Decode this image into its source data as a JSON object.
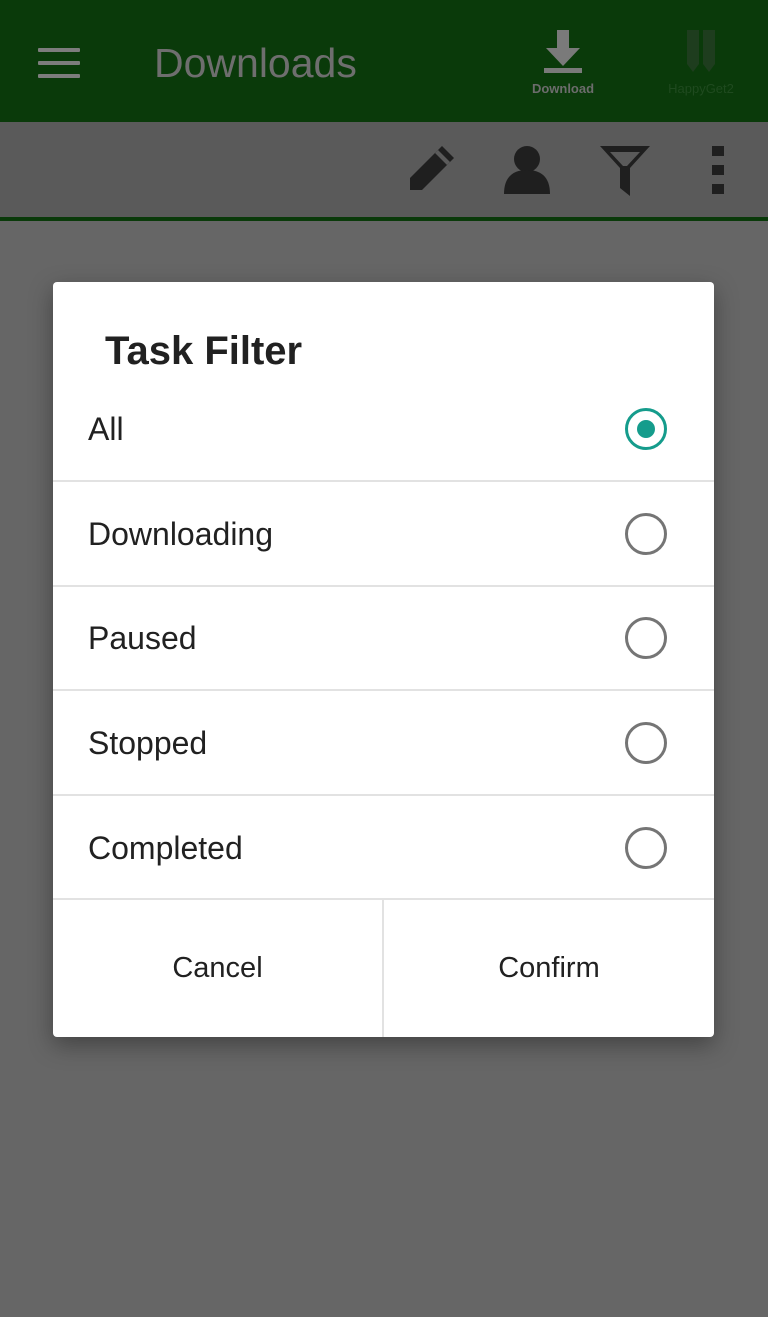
{
  "appbar": {
    "title": "Downloads",
    "download_label": "Download",
    "happyget_label": "HappyGet2",
    "icons": [
      "menu-icon",
      "download-icon",
      "happyget-logo-icon"
    ]
  },
  "toolbar": {
    "icons": [
      "edit-pencil-icon",
      "user-icon",
      "filter-icon",
      "more-vert-icon"
    ]
  },
  "dialog": {
    "title": "Task Filter",
    "options": [
      {
        "label": "All",
        "selected": true
      },
      {
        "label": "Downloading",
        "selected": false
      },
      {
        "label": "Paused",
        "selected": false
      },
      {
        "label": "Stopped",
        "selected": false
      },
      {
        "label": "Completed",
        "selected": false
      }
    ],
    "cancel_label": "Cancel",
    "confirm_label": "Confirm"
  },
  "colors": {
    "appbar": "#0a3a0a",
    "accent": "#159c8c",
    "scrim_background": "#666666"
  }
}
